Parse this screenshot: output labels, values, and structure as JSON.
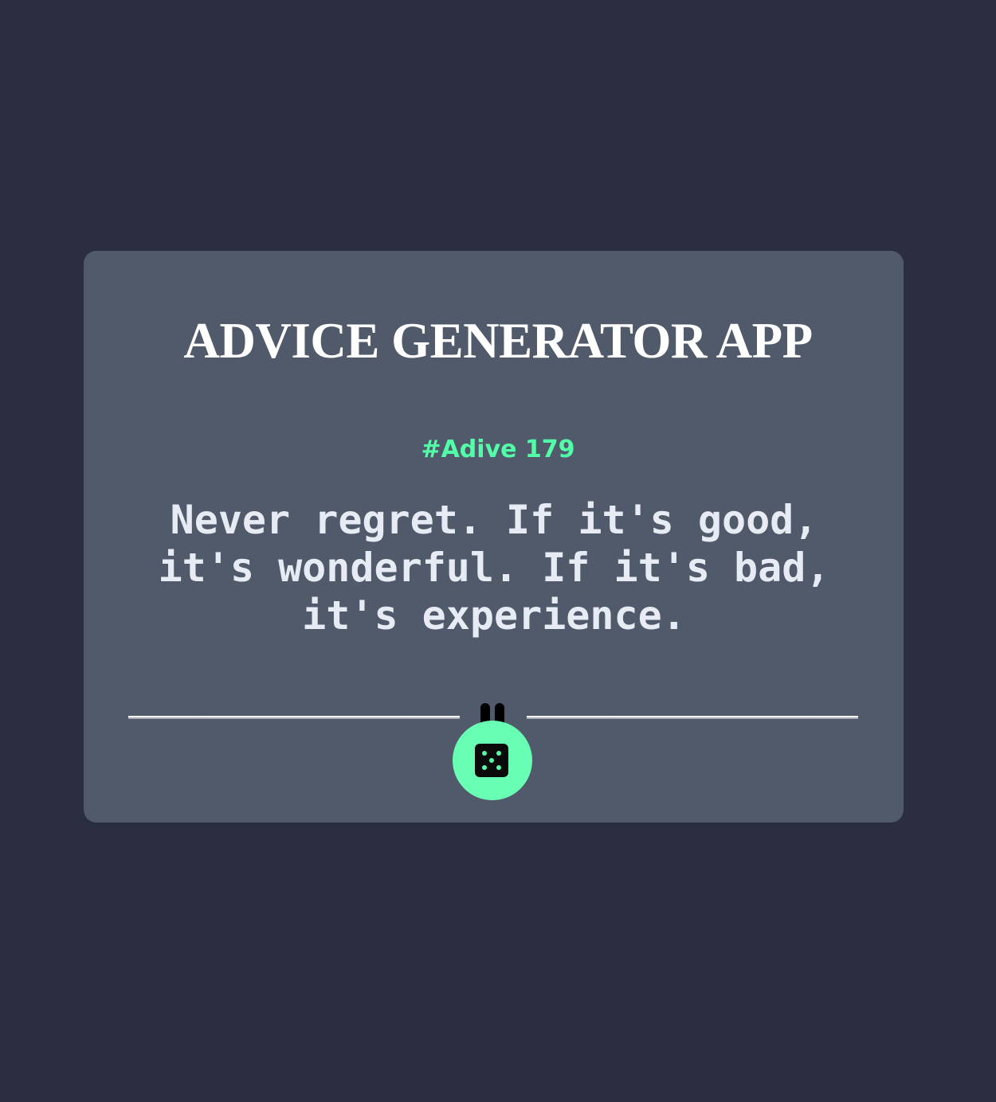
{
  "app": {
    "title": "ADVICE GENERATOR APP"
  },
  "advice": {
    "id_label": "#Adive 179",
    "text": "Never regret. If it's good, it's wonderful. If it's bad, it's experience."
  },
  "controls": {
    "divider_icon": "pause-icon",
    "generate_icon": "dice-icon"
  },
  "colors": {
    "background": "#2b2e41",
    "card": "#515a6b",
    "accent": "#52ffa8",
    "button": "#68ffb4",
    "title": "#ffffff",
    "text": "#e7ecf4"
  }
}
